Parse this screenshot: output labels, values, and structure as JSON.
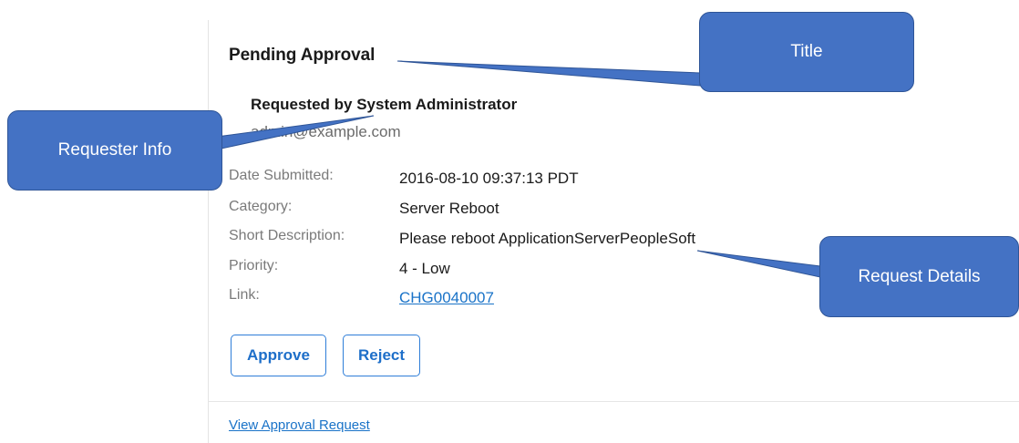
{
  "card": {
    "title": "Pending Approval",
    "requester": {
      "name": "Requested by System Administrator",
      "email": "admin@example.com"
    },
    "details": [
      {
        "label": "Date Submitted:",
        "value": "2016-08-10 09:37:13 PDT"
      },
      {
        "label": "Category:",
        "value": "Server Reboot"
      },
      {
        "label": "Short Description:",
        "value": "Please reboot ApplicationServerPeopleSoft"
      },
      {
        "label": "Priority:",
        "value": "4 - Low"
      },
      {
        "label": "Link:",
        "value": "CHG0040007"
      }
    ],
    "buttons": {
      "approve": "Approve",
      "reject": "Reject"
    },
    "footer_link": "View Approval Request"
  },
  "callouts": {
    "title": "Title",
    "requester_info": "Requester Info",
    "request_details": "Request Details"
  },
  "colors": {
    "accent": "#1e6fc9",
    "callout": "#4472c4"
  }
}
